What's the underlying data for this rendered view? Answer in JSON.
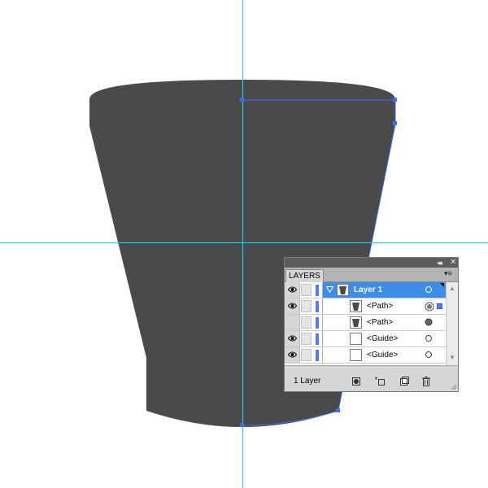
{
  "panel": {
    "tab_label": "LAYERS",
    "collapse_glyph": "◂◂",
    "close_glyph": "✕",
    "menu_glyph": "▾≡",
    "layer_count": "1 Layer"
  },
  "layers": [
    {
      "label": "Layer 1",
      "kind": "layer",
      "visible": true,
      "selected": true
    },
    {
      "label": "<Path>",
      "kind": "path",
      "visible": true,
      "selected": false,
      "has_selection_square": true
    },
    {
      "label": "<Path>",
      "kind": "path",
      "visible": false,
      "selected": false
    },
    {
      "label": "<Guide>",
      "kind": "guide",
      "visible": true,
      "selected": false
    },
    {
      "label": "<Guide>",
      "kind": "guide",
      "visible": true,
      "selected": false
    }
  ],
  "footer_icons": [
    "make-clipping-mask-icon",
    "create-sublayer-icon",
    "create-new-layer-icon",
    "duplicate-icon",
    "trash-icon"
  ],
  "colors": {
    "shape_fill": "#4a4a4a",
    "guide": "#00e5ff",
    "selection": "#3d6df0",
    "layer_color": "#4f7cf5",
    "selected_row": "#3d8ee9"
  }
}
